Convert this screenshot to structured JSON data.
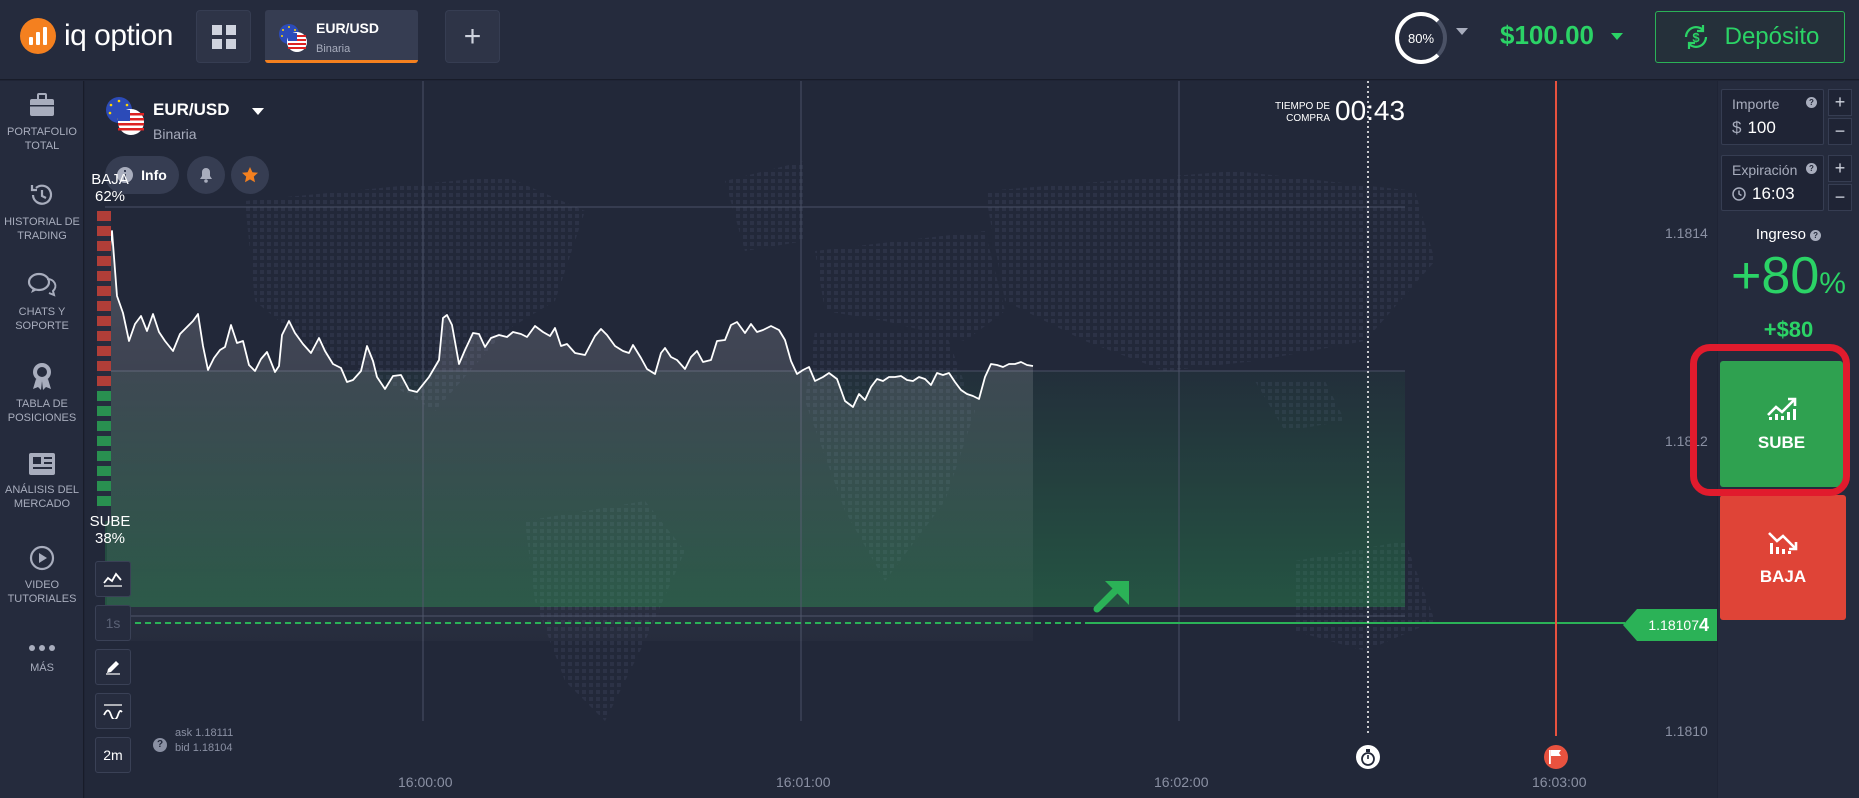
{
  "brand": {
    "name": "iq option"
  },
  "top_bar": {
    "asset_tab": {
      "pair": "EUR/USD",
      "type": "Binaria"
    },
    "add_tab_label": "+",
    "profit_gauge": "80%",
    "balance": "$100.00",
    "deposit_label": "Depósito"
  },
  "sidebar": {
    "items": [
      {
        "label": "PORTAFOLIO TOTAL",
        "icon": "briefcase-icon"
      },
      {
        "label": "HISTORIAL DE TRADING",
        "icon": "history-icon"
      },
      {
        "label": "CHATS Y SOPORTE",
        "icon": "chat-icon"
      },
      {
        "label": "TABLA DE POSICIONES",
        "icon": "medal-icon"
      },
      {
        "label": "ANÁLISIS DEL MERCADO",
        "icon": "news-icon"
      },
      {
        "label": "VIDEO TUTORIALES",
        "icon": "play-icon"
      },
      {
        "label": "MÁS",
        "icon": "more-icon"
      }
    ]
  },
  "chart": {
    "asset": {
      "pair": "EUR/USD",
      "type": "Binaria"
    },
    "info_label": "Info",
    "timer_label_line1": "TIEMPO DE",
    "timer_label_line2": "COMPRA",
    "timer": "00:43",
    "baja_label": "BAJA",
    "baja_pct": "62%",
    "sube_label": "SUBE",
    "sube_pct": "38%",
    "tools": {
      "timeframe": "1s",
      "period": "2m"
    },
    "ask": "ask 1.18111",
    "bid": "bid 1.18104",
    "current_price_main": "1.18107",
    "current_price_last": "4",
    "y_labels": [
      "1.1814",
      "1.1812",
      "1.1810"
    ],
    "x_labels": [
      "16:00:00",
      "16:01:00",
      "16:02:00",
      "16:03:00"
    ],
    "colors": {
      "up": "#2bb257",
      "down": "#df4437",
      "line": "#ffffff",
      "expiry": "#e8523f"
    }
  },
  "right_panel": {
    "amount": {
      "label": "Importe",
      "currency": "$",
      "value": "100"
    },
    "expiration": {
      "label": "Expiración",
      "value": "16:03"
    },
    "income_label": "Ingreso",
    "income_pct_value": "+80",
    "income_pct_sign": "%",
    "income_amount": "+$80",
    "sube_label": "SUBE",
    "baja_label": "BAJA"
  }
}
